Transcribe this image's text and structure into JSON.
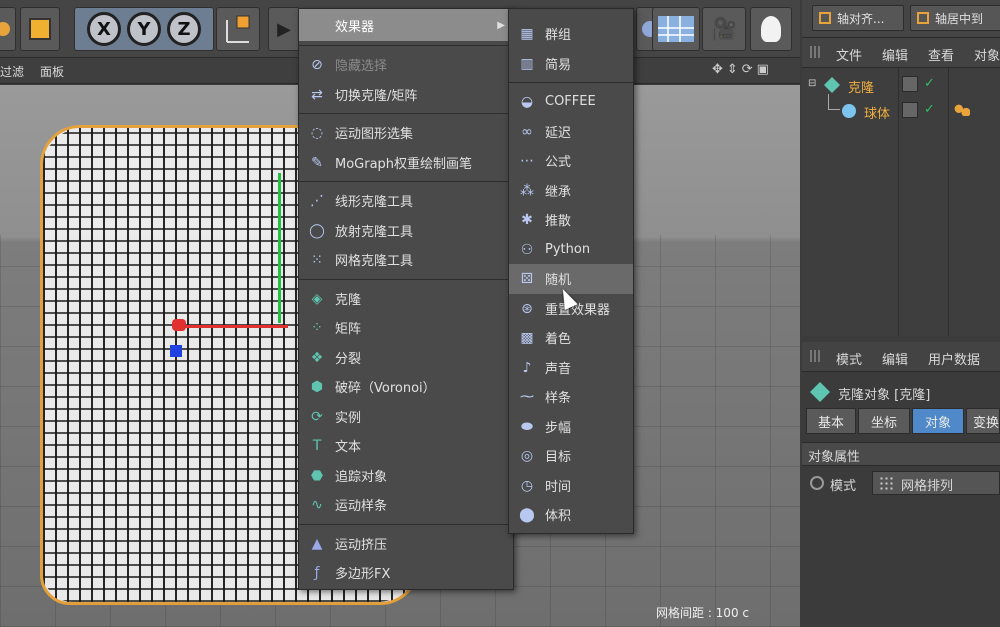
{
  "toolbar": {
    "axis_x": "X",
    "axis_y": "Y",
    "axis_z": "Z"
  },
  "viewport": {
    "menu_filter": "过滤",
    "menu_panel": "面板",
    "grid_spacing": "网格间距 : 100 c"
  },
  "mograph_menu": {
    "effectors_label": "效果器",
    "items": [
      {
        "label": "隐藏选择",
        "icon": "hide-selection-icon",
        "disabled": true
      },
      {
        "label": "切换克隆/矩阵",
        "icon": "toggle-clone-matrix-icon"
      },
      {
        "label": "运动图形选集",
        "icon": "mograph-selection-icon"
      },
      {
        "label": "MoGraph权重绘制画笔",
        "icon": "weight-paint-brush-icon"
      },
      {
        "label": "线形克隆工具",
        "icon": "linear-clone-tool-icon"
      },
      {
        "label": "放射克隆工具",
        "icon": "radial-clone-tool-icon"
      },
      {
        "label": "网格克隆工具",
        "icon": "grid-clone-tool-icon"
      },
      {
        "label": "克隆",
        "icon": "cloner-icon"
      },
      {
        "label": "矩阵",
        "icon": "matrix-icon"
      },
      {
        "label": "分裂",
        "icon": "fracture-icon"
      },
      {
        "label": "破碎（Voronoi）",
        "icon": "voronoi-fracture-icon"
      },
      {
        "label": "实例",
        "icon": "instance-icon"
      },
      {
        "label": "文本",
        "icon": "text-icon"
      },
      {
        "label": "追踪对象",
        "icon": "tracer-icon"
      },
      {
        "label": "运动样条",
        "icon": "mospline-icon"
      },
      {
        "label": "运动挤压",
        "icon": "moextrude-icon"
      },
      {
        "label": "多边形FX",
        "icon": "polyfx-icon"
      }
    ]
  },
  "effector_submenu": {
    "items": [
      {
        "label": "群组",
        "icon": "group-effector-icon"
      },
      {
        "label": "简易",
        "icon": "plain-effector-icon"
      },
      {
        "label": "COFFEE",
        "icon": "coffee-effector-icon"
      },
      {
        "label": "延迟",
        "icon": "delay-effector-icon"
      },
      {
        "label": "公式",
        "icon": "formula-effector-icon"
      },
      {
        "label": "继承",
        "icon": "inheritance-effector-icon"
      },
      {
        "label": "推散",
        "icon": "push-apart-effector-icon"
      },
      {
        "label": "Python",
        "icon": "python-effector-icon"
      },
      {
        "label": "随机",
        "icon": "random-effector-icon",
        "highlighted": true
      },
      {
        "label": "重置效果器",
        "icon": "reeffector-icon"
      },
      {
        "label": "着色",
        "icon": "shader-effector-icon"
      },
      {
        "label": "声音",
        "icon": "sound-effector-icon"
      },
      {
        "label": "样条",
        "icon": "spline-effector-icon"
      },
      {
        "label": "步幅",
        "icon": "step-effector-icon"
      },
      {
        "label": "目标",
        "icon": "target-effector-icon"
      },
      {
        "label": "时间",
        "icon": "time-effector-icon"
      },
      {
        "label": "体积",
        "icon": "volume-effector-icon"
      }
    ]
  },
  "top_right": {
    "axis_align": "轴对齐...",
    "axis_center": "轴居中到"
  },
  "object_manager": {
    "menu": [
      "文件",
      "编辑",
      "查看",
      "对象"
    ],
    "objects": [
      {
        "name": "克隆",
        "icon": "cloner-icon"
      },
      {
        "name": "球体",
        "icon": "sphere-icon"
      }
    ]
  },
  "attribute_manager": {
    "menu": [
      "模式",
      "编辑",
      "用户数据"
    ],
    "object_title": "克隆对象 [克隆]",
    "tabs": [
      "基本",
      "坐标",
      "对象",
      "变换"
    ],
    "active_tab": "对象",
    "section_title": "对象属性",
    "mode_label": "模式",
    "mode_value": "网格排列"
  },
  "colors": {
    "accent_orange": "#e8a33a",
    "active_tab": "#4f89c9",
    "menu_bg": "#4a4a4a"
  }
}
